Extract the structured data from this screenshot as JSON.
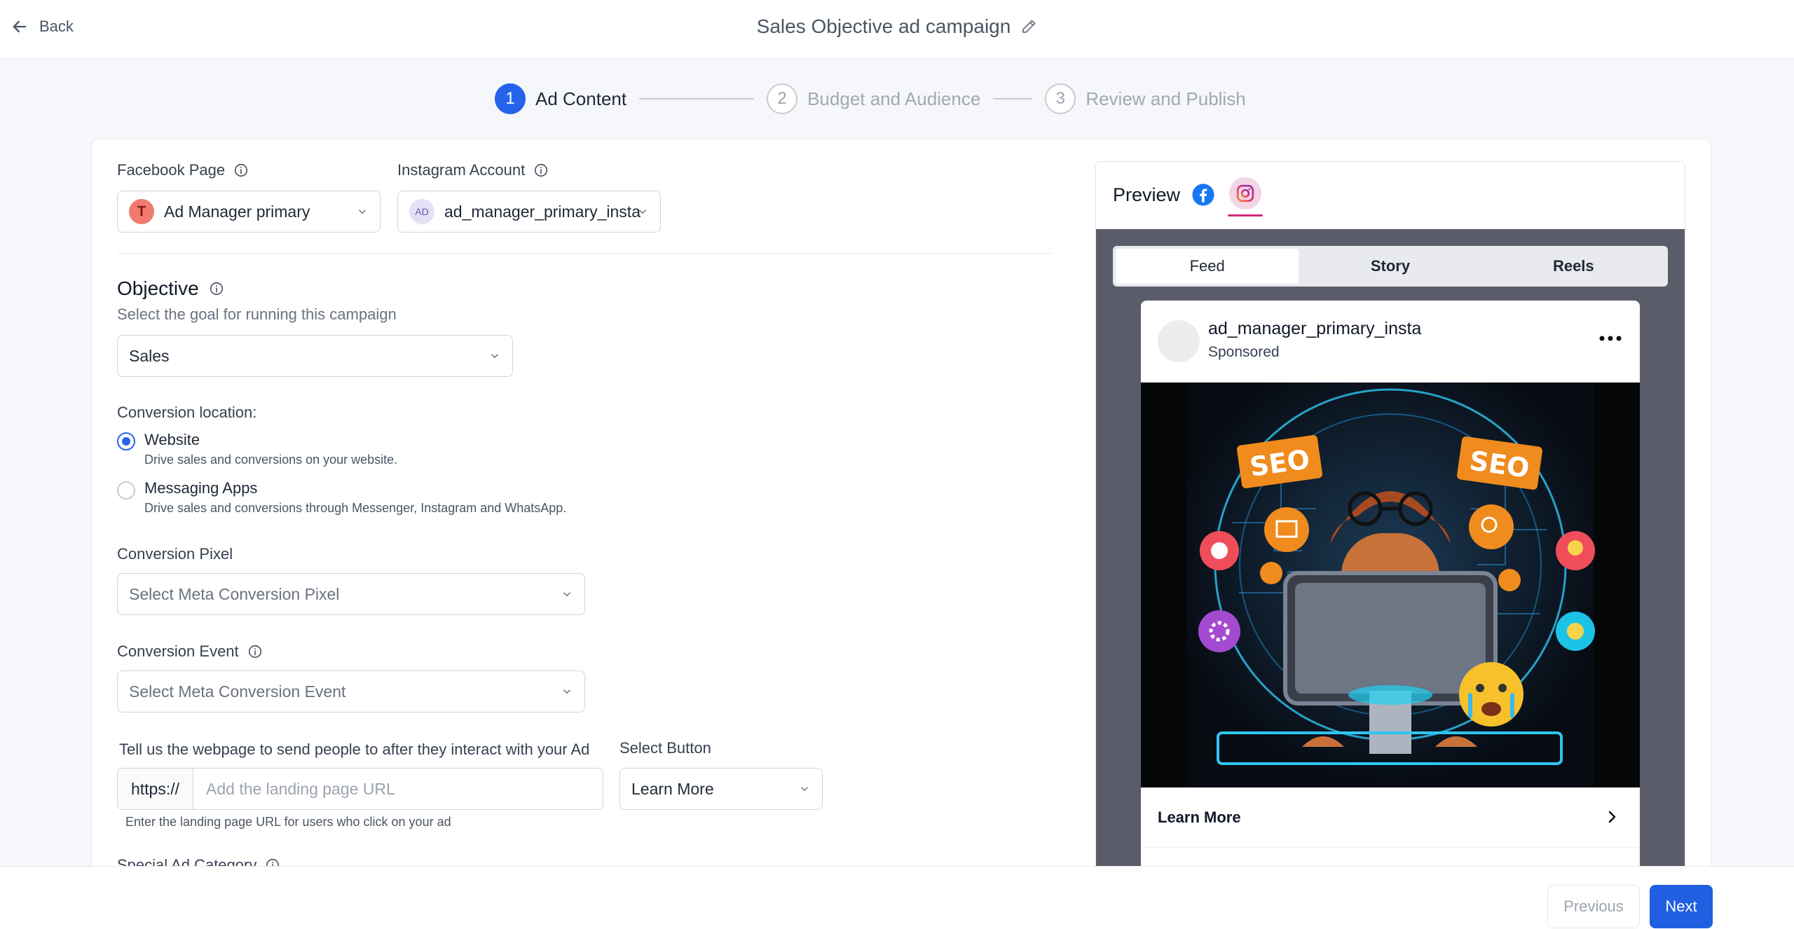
{
  "header": {
    "back_label": "Back",
    "title": "Sales Objective ad campaign"
  },
  "stepper": {
    "steps": [
      {
        "num": "1",
        "label": "Ad Content",
        "state": "active"
      },
      {
        "num": "2",
        "label": "Budget and Audience",
        "state": "inactive"
      },
      {
        "num": "3",
        "label": "Review and Publish",
        "state": "inactive"
      }
    ]
  },
  "form": {
    "facebook_page": {
      "label": "Facebook Page",
      "avatar_letter": "T",
      "value": "Ad Manager primary"
    },
    "instagram_account": {
      "label": "Instagram Account",
      "avatar_text": "AD",
      "value": "ad_manager_primary_insta"
    },
    "objective": {
      "heading": "Objective",
      "subtitle": "Select the goal for running this campaign",
      "value": "Sales"
    },
    "conversion_location": {
      "label": "Conversion location:",
      "options": [
        {
          "title": "Website",
          "description": "Drive sales and conversions on your website.",
          "checked": true
        },
        {
          "title": "Messaging Apps",
          "description": "Drive sales and conversions through Messenger, Instagram and WhatsApp.",
          "checked": false
        }
      ]
    },
    "conversion_pixel": {
      "label": "Conversion Pixel",
      "placeholder": "Select Meta Conversion Pixel"
    },
    "conversion_event": {
      "label": "Conversion Event",
      "placeholder": "Select Meta Conversion Event"
    },
    "landing_page": {
      "label": "Tell us the webpage to send people to after they interact with your Ad",
      "prefix": "https://",
      "placeholder": "Add the landing page URL",
      "value": "",
      "help": "Enter the landing page URL for users who click on your ad"
    },
    "select_button": {
      "label": "Select Button",
      "value": "Learn More"
    },
    "special_ad_category": {
      "label": "Special Ad Category"
    }
  },
  "preview": {
    "title": "Preview",
    "tabs": [
      "Feed",
      "Story",
      "Reels"
    ],
    "active_tab": "Feed",
    "post": {
      "username": "ad_manager_primary_insta",
      "sponsored": "Sponsored",
      "image_text_left": "SEO",
      "image_text_right": "SEO",
      "cta_label": "Learn More"
    }
  },
  "footer": {
    "previous_label": "Previous",
    "next_label": "Next"
  },
  "colors": {
    "primary": "#2563eb",
    "next_button": "#1f5fe0",
    "instagram_accent": "#d6287a",
    "facebook_blue": "#1877f2"
  }
}
